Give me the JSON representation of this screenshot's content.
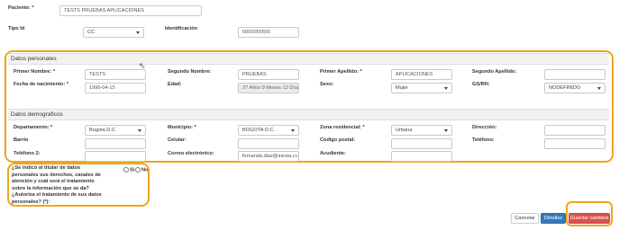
{
  "header": {
    "patient_label": "Paciente: *",
    "patient_value": "TESTS PRUEBAS APLICACIONES",
    "id_type_label": "Tipo Id",
    "id_type_value": "CC",
    "identification_label": "Identificación",
    "identification_value": "0000055555"
  },
  "personal": {
    "title": "Datos personales",
    "first_name_label": "Primer Nombre: *",
    "first_name_value": "TESTS",
    "second_name_label": "Segundo Nombre:",
    "second_name_value": "PRUEBAS",
    "first_surname_label": "Primer Apellido: *",
    "first_surname_value": "APLICACIONES",
    "second_surname_label": "Segundo Apellido:",
    "second_surname_value": "",
    "birth_label": "Fecha de nacimiento: *",
    "birth_value": "1996-04-15",
    "age_label": "Edad:",
    "age_value": "27 Años 9 Meses 12 Días",
    "sex_label": "Sexo:",
    "sex_value": "Mujer",
    "blood_label": "GS/RH:",
    "blood_value": "NODEFINIDO"
  },
  "demographic": {
    "title": "Datos demograficos",
    "department_label": "Departamento: *",
    "department_value": "Bogota D.C",
    "municipality_label": "Municipio: *",
    "municipality_value": "BOGOTA D.C.",
    "zone_label": "Zona residencial: *",
    "zone_value": "Urbana",
    "address_label": "Dirección:",
    "address_value": "",
    "neighborhood_label": "Barrio",
    "neighborhood_value": "",
    "cellphone_label": "Celular:",
    "cellphone_value": "",
    "postal_label": "Código postal:",
    "postal_value": "",
    "phone_label": "Teléfono:",
    "phone_value": "",
    "phone2_label": "Teléfono 2:",
    "phone2_value": "",
    "email_label": "Correo electrónico:",
    "email_value": "fernanda.diaz@inexta.cc",
    "guardian_label": "Acudiente:",
    "guardian_value": ""
  },
  "consent": {
    "lines": [
      "¿Se indicó al titular de datos",
      "personales sus derechos, canales de",
      "atención y cuál será el tratamiento",
      "sobre la información que se da?",
      "¿Autoriza el tratamiento de sus datos",
      "personales? (*):"
    ],
    "yes_label": "Si",
    "no_label": "No"
  },
  "actions": {
    "cancel_label": "Cancelar",
    "details_label": "Detalles",
    "save_label": "Guardar cambios"
  },
  "colors": {
    "highlight": "#f0a51c",
    "primary": "#337ab7",
    "danger": "#d9534f"
  }
}
